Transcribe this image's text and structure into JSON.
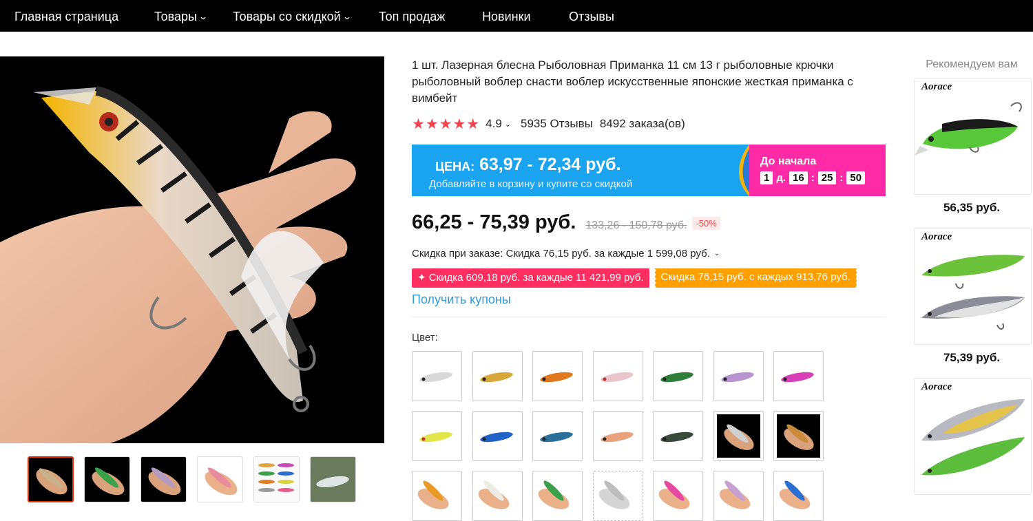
{
  "nav": {
    "items": [
      {
        "label": "Главная страница"
      },
      {
        "label": "Товары",
        "chevron": "⌄"
      },
      {
        "label": "Товары со скидкой",
        "chevron": "⌄"
      },
      {
        "label": "Топ продаж"
      },
      {
        "label": "Новинки"
      },
      {
        "label": "Отзывы"
      }
    ]
  },
  "product": {
    "title": "1 шт. Лазерная блесна Рыболовная Приманка 11 см 13 г рыболовные крючки рыболовный воблер снасти воблер искусственные японские жесткая приманка с вимбейт",
    "stars": "★★★★★",
    "rating": "4.9",
    "reviews": "5935 Отзывы",
    "orders": "8492 заказа(ов)",
    "price": "66,25 - 75,39 руб.",
    "old_price": "133,26 - 150,78 руб.",
    "discount": "-50%",
    "order_discount": "Скидка при заказе: Скидка 76,15 руб. за каждые 1 599,08 руб.",
    "coupons": [
      "✦ Скидка 609,18 руб. за каждые 11 421,99 руб.",
      "Скидка 76,15 руб. с каждых 913,76 руб."
    ],
    "get_coupons": "Получить купоны",
    "color_label": "Цвет:"
  },
  "promo": {
    "label": "ЦЕНА:",
    "price": "63,97 - 72,34 руб.",
    "subtitle": "Добавляйте в корзину и купите со скидкой",
    "countdown_label": "До начала",
    "days": "1",
    "days_unit": "д.",
    "hours": "16",
    "minutes": "25",
    "seconds": "50",
    "colors": {
      "blue": "#1aa4f0",
      "pink": "#ff2ba6"
    }
  },
  "recommend": {
    "title": "Рекомендуем вам",
    "items": [
      {
        "brand": "Aorace",
        "price": "56,35 руб."
      },
      {
        "brand": "Aorace",
        "price": "75,39 руб."
      },
      {
        "brand": "Aorace"
      }
    ]
  },
  "colors": {
    "accent_red": "#f0434b",
    "link_blue": "#2e9bd6",
    "coupon_red": "#ff2e60",
    "coupon_orange": "#ff9f00"
  }
}
